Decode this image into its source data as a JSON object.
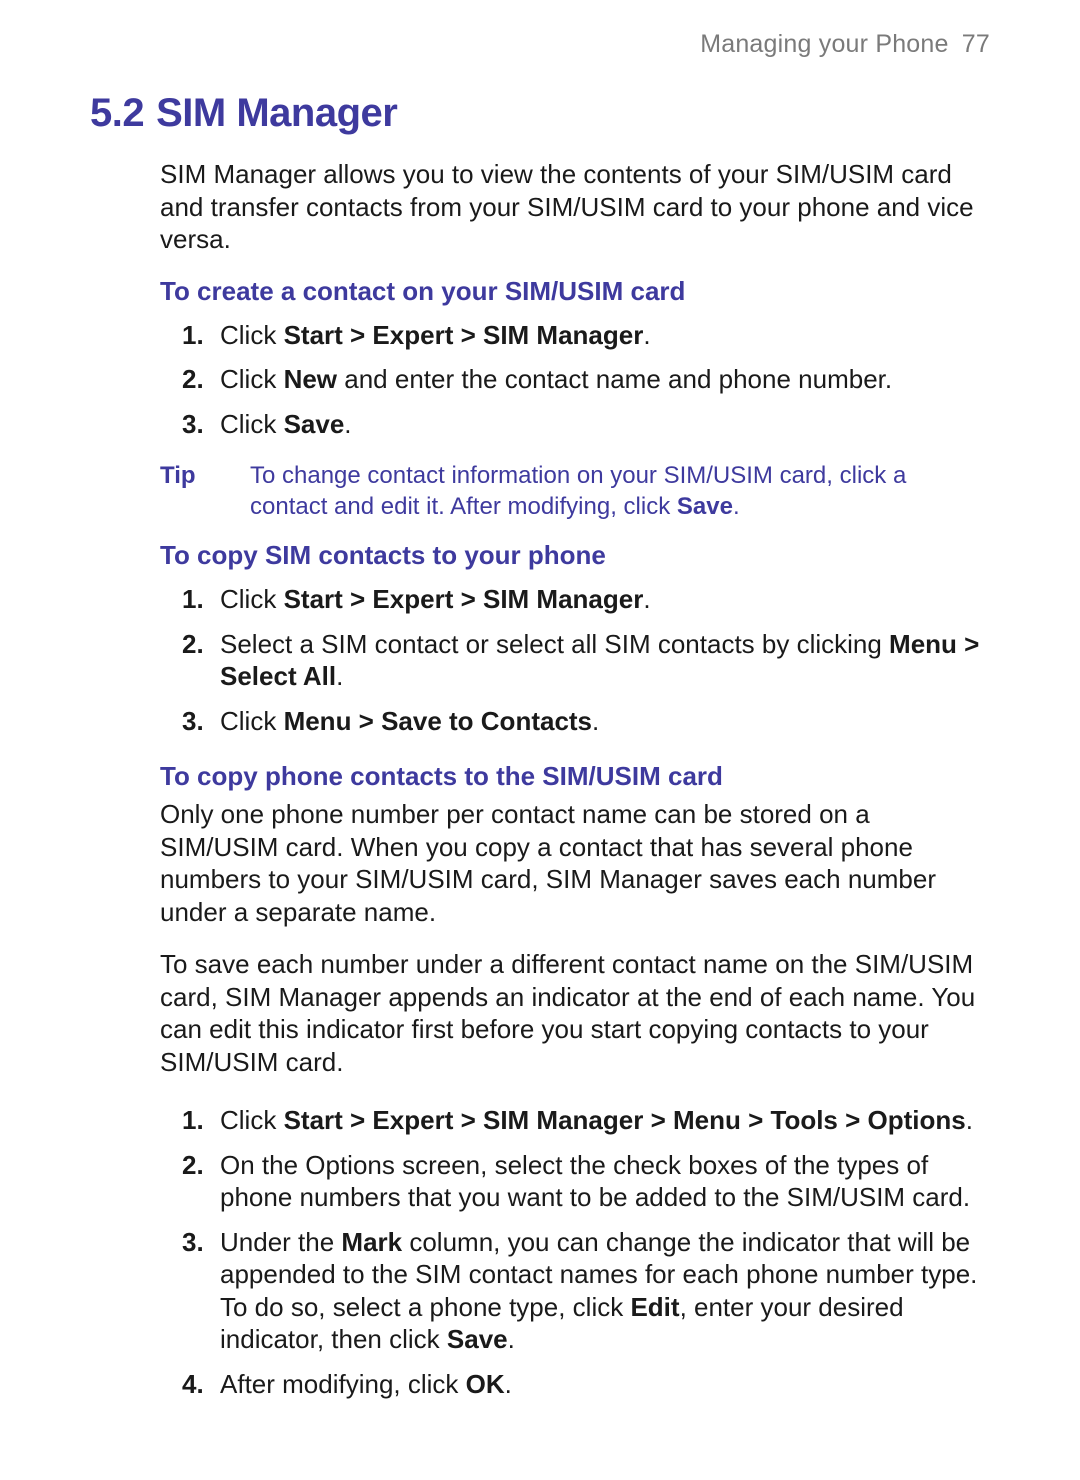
{
  "header": {
    "label": "Managing your Phone",
    "page": "77"
  },
  "title": {
    "num": "5.2",
    "text": "SIM Manager"
  },
  "intro": "SIM Manager allows you to view the contents of your SIM/USIM card and transfer contacts from your SIM/USIM card to your phone and vice versa.",
  "sec1": {
    "head": "To create a contact on your SIM/USIM card",
    "s1_pre": "Click ",
    "s1_b": "Start > Expert > SIM Manager",
    "s1_post": ".",
    "s2_pre": "Click ",
    "s2_b": "New",
    "s2_post": " and enter the contact name and phone number.",
    "s3_pre": "Click ",
    "s3_b": "Save",
    "s3_post": "."
  },
  "tip": {
    "label": "Tip",
    "t1": "To change contact information on your SIM/USIM card, click a contact and edit it. After modifying, click ",
    "tb": "Save",
    "t2": "."
  },
  "sec2": {
    "head": "To copy SIM contacts to your phone",
    "s1_pre": "Click ",
    "s1_b": "Start > Expert > SIM Manager",
    "s1_post": ".",
    "s2_pre": "Select a SIM contact or select all SIM contacts by clicking ",
    "s2_b": "Menu > Select All",
    "s2_post": ".",
    "s3_pre": "Click ",
    "s3_b": "Menu > Save to Contacts",
    "s3_post": "."
  },
  "sec3": {
    "head": "To copy phone contacts to the SIM/USIM card",
    "p1": "Only one phone number per contact name can be stored on a SIM/USIM card. When you copy a contact that has several phone numbers to your SIM/USIM card, SIM Manager saves each number under a separate name.",
    "p2": "To save each number under a different contact name on the SIM/USIM card, SIM Manager appends an indicator at the end of each name. You can edit this indicator first before you start copying contacts to your SIM/USIM card.",
    "s1_pre": "Click ",
    "s1_b": "Start > Expert > SIM Manager > Menu > Tools > Options",
    "s1_post": ".",
    "s2": "On the Options screen, select the check boxes of the types of phone numbers that you want to be added to the SIM/USIM card.",
    "s3_a": "Under the ",
    "s3_b1": "Mark",
    "s3_c": " column, you can change the indicator that will be appended to the SIM contact names for each phone number type. To do so, select a phone type, click ",
    "s3_b2": "Edit",
    "s3_d": ", enter your desired indicator, then click ",
    "s3_b3": "Save",
    "s3_e": ".",
    "s4_pre": "After modifying, click ",
    "s4_b": "OK",
    "s4_post": "."
  },
  "markers": {
    "m1": "1.",
    "m2": "2.",
    "m3": "3.",
    "m4": "4."
  }
}
